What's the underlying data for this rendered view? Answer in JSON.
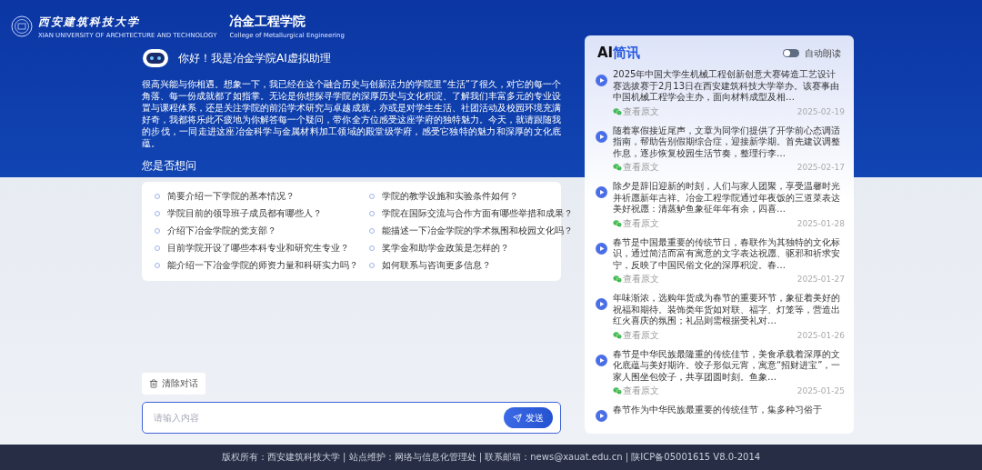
{
  "header": {
    "university_name": "西安建筑科技大学",
    "university_name_en": "XIAN UNIVERSITY OF ARCHITECTURE AND TECHNOLOGY",
    "college_name": "冶金工程学院",
    "college_name_en": "College of Metallurgical Engineering"
  },
  "assistant": {
    "greeting": "你好！我是冶金学院AI虚拟助理",
    "intro": "很高兴能与你相遇。想象一下，我已经在这个融合历史与创新活力的学院里“生活”了很久，对它的每一个角落、每一份成就都了如指掌。无论是你想探寻学院的深厚历史与文化积淀、了解我们丰富多元的专业设置与课程体系，还是关注学院的前沿学术研究与卓越成就，亦或是对学生生活、社团活动及校园环境充满好奇，我都将乐此不疲地为你解答每一个疑问，带你全方位感受这座学府的独特魅力。今天，就请跟随我的步伐，一同走进这座冶金科学与金属材料加工领域的殿堂级学府，感受它独特的魅力和深厚的文化底蕴。"
  },
  "suggestions": {
    "title": "您是否想问",
    "questions": [
      "简要介绍一下学院的基本情况？",
      "学院的教学设施和实验条件如何？",
      "学院目前的领导班子成员都有哪些人？",
      "学院在国际交流与合作方面有哪些举措和成果？",
      "介绍下冶金学院的党支部？",
      "能描述一下冶金学院的学术氛围和校园文化吗？",
      "目前学院开设了哪些本科专业和研究生专业？",
      "奖学金和助学金政策是怎样的？",
      "能介绍一下冶金学院的师资力量和科研实力吗？",
      "如何联系与咨询更多信息？"
    ]
  },
  "news": {
    "title_prefix": "AI",
    "title_highlight": "简讯",
    "auto_read": {
      "label": "自动朗读",
      "on": false
    },
    "items": [
      {
        "text": "2025年中国大学生机械工程创新创意大赛铸造工艺设计赛选拔赛于2月13日在西安建筑科技大学举办。该赛事由中国机械工程学会主办，面向材料成型及相…",
        "link": "查看原文",
        "date": "2025-02-19"
      },
      {
        "text": "随着寒假接近尾声，文章为同学们提供了开学前心态调适指南，帮助告别假期综合症，迎接新学期。首先建议调整作息，逐步恢复校园生活节奏，整理行李…",
        "link": "查看原文",
        "date": "2025-02-17"
      },
      {
        "text": "除夕是辞旧迎新的时刻，人们与家人团聚，享受温馨时光并祈愿新年吉祥。冶金工程学院通过年夜饭的三道菜表达美好祝愿：清蒸鲈鱼象征年年有余，四喜…",
        "link": "查看原文",
        "date": "2025-01-28"
      },
      {
        "text": "春节是中国最重要的传统节日，春联作为其独特的文化标识，通过简洁而富有寓意的文字表达祝愿、驱邪和祈求安宁，反映了中国民俗文化的深厚积淀。春…",
        "link": "查看原文",
        "date": "2025-01-27"
      },
      {
        "text": "年味渐浓，选购年货成为春节的重要环节，象征着美好的祝福和期待。装饰类年货如对联、福字、灯笼等，营造出红火喜庆的氛围；礼品则需根据受礼对…",
        "link": "查看原文",
        "date": "2025-01-26"
      },
      {
        "text": "春节是中华民族最隆重的传统佳节，美食承载着深厚的文化底蕴与美好期许。饺子形似元宵，寓意“招财进宝”，一家人围坐包饺子，共享团圆时刻。鱼象…",
        "link": "查看原文",
        "date": "2025-01-25"
      },
      {
        "text": "春节作为中华民族最重要的传统佳节，集多种习俗于"
      }
    ]
  },
  "chat": {
    "clear_button": "清除对话",
    "input_placeholder": "请输入内容",
    "send_button": "发送"
  },
  "footer": "版权所有：西安建筑科技大学 | 站点维护：网络与信息化管理处 | 联系邮箱：news@xauat.edu.cn | 陕ICP备05001615 V8.0-2014"
}
